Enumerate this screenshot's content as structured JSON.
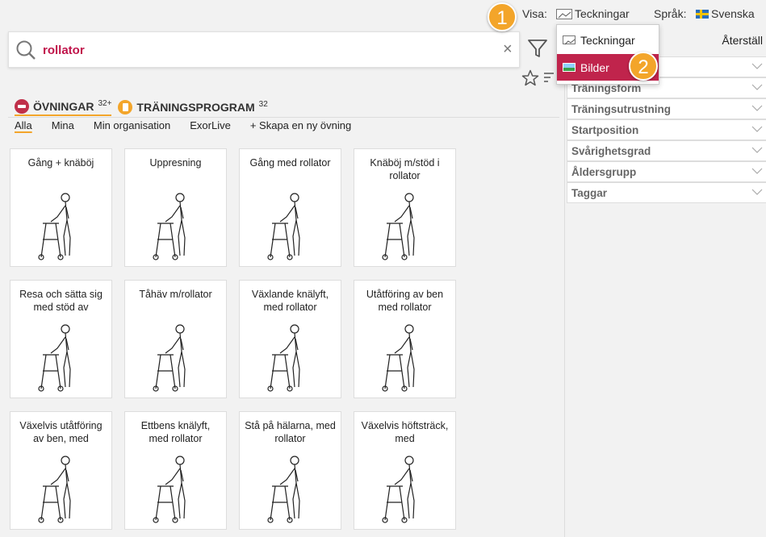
{
  "topbar": {
    "visa_label": "Visa:",
    "visa_value": "Teckningar",
    "sprak_label": "Språk:",
    "sprak_value": "Svenska"
  },
  "dropdown": {
    "items": [
      {
        "label": "Teckningar",
        "icon": "drawing-icon"
      },
      {
        "label": "Bilder",
        "icon": "picture-icon"
      }
    ]
  },
  "badges": [
    "1",
    "2"
  ],
  "search": {
    "value": "rollator",
    "clear_symbol": "×"
  },
  "categories": [
    {
      "label": "ÖVNINGAR",
      "count": "32+",
      "icon": "dumbbell-icon"
    },
    {
      "label": "TRÄNINGSPROGRAM",
      "count": "32",
      "icon": "document-icon"
    }
  ],
  "subtabs": [
    "Alla",
    "Mina",
    "Min organisation",
    "ExorLive",
    "+ Skapa en ny övning"
  ],
  "exercises": [
    "Gång + knäböj",
    "Uppresning",
    "Gång med rollator",
    "Knäböj m/stöd i rollator",
    "Resa och sätta sig med stöd av",
    "Tåhäv m/rollator",
    "Växlande knälyft, med rollator",
    "Utåtföring av ben med rollator",
    "Växelvis utåtföring av ben, med",
    "Ettbens knälyft, med rollator",
    "Stå på hälarna, med rollator",
    "Växelvis höftsträck, med"
  ],
  "filter_panel": {
    "reset_label": "Återställ",
    "rows": [
      "",
      "Träningsform",
      "Träningsutrustning",
      "Startposition",
      "Svårighetsgrad",
      "Åldersgrupp",
      "Taggar"
    ]
  },
  "colors": {
    "accent": "#c0244c",
    "badge": "#f3a52a",
    "search_text": "#c0134a"
  }
}
